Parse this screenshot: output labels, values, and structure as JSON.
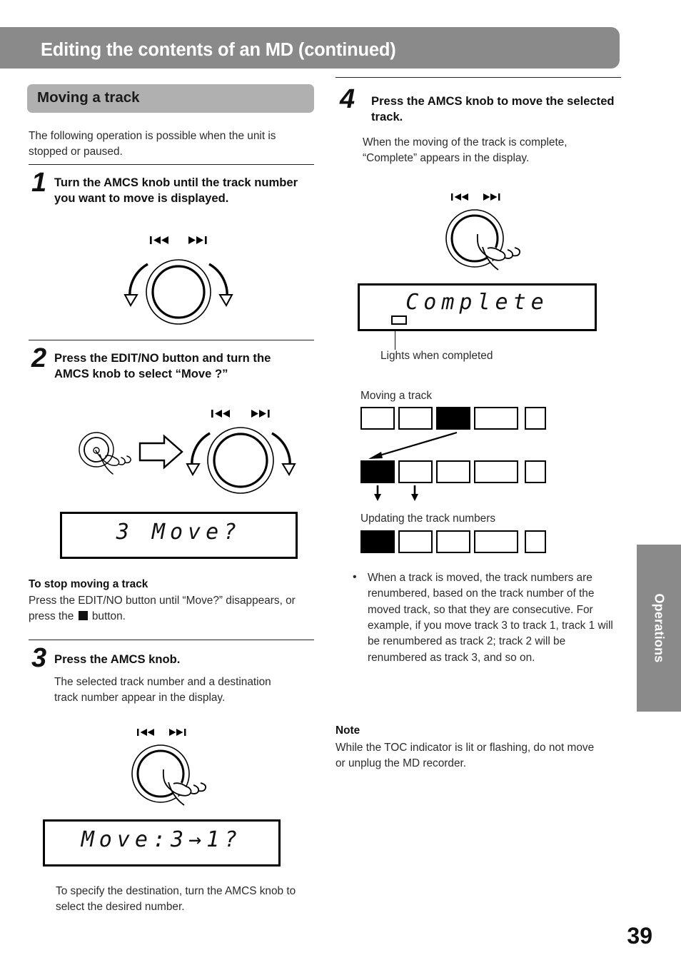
{
  "header": {
    "title": "Editing the contents of an MD (continued)",
    "banner_color": "#8a8a8a"
  },
  "side_tab": {
    "label": "Operations",
    "color": "#8a8a8a"
  },
  "page_number": "39",
  "left_column": {
    "section_heading": "Moving a track",
    "intro": "The following operation is possible when the unit is stopped or paused.",
    "steps": [
      {
        "number": "1",
        "title": "Turn the AMCS knob until the track number you want to move is displayed.",
        "illustration": "knob-rotate",
        "skip_back_icon": "skip-back-icon",
        "skip_fwd_icon": "skip-forward-icon"
      },
      {
        "number": "2",
        "title": "Press the EDIT/NO button and turn the AMCS knob to select “Move ?”",
        "illustration": "press-then-rotate",
        "display_text": "3 Move?"
      },
      {
        "number": "3",
        "title": "Press the AMCS knob.",
        "body": "The selected track number and a destination track number appear in the display.",
        "illustration": "knob-press",
        "display_text": "Move:3→1?",
        "footnote": "To specify the destination, turn the AMCS knob to select the desired number."
      }
    ],
    "stop_section": {
      "heading": "To stop moving a track",
      "text_before": "Press the EDIT/NO button until “Move?” disappears, or press the",
      "text_after": "button.",
      "stop_icon": "stop-button-icon"
    }
  },
  "right_column": {
    "step": {
      "number": "4",
      "title": "Press the AMCS knob to move the selected track.",
      "body": "When the moving of the track is complete, “Complete” appears in the display.",
      "illustration": "knob-press",
      "display_text": "Complete",
      "indicator_caption": "Lights when completed"
    },
    "diagram": {
      "label_top": "Moving a track",
      "label_bottom": "Updating the track numbers",
      "row1": [
        "empty",
        "empty",
        "filled",
        "empty",
        "empty"
      ],
      "row2": [
        "filled",
        "empty",
        "empty",
        "empty",
        "empty"
      ],
      "row3": [
        "filled",
        "empty",
        "empty",
        "empty",
        "empty"
      ]
    },
    "bullet": "When a track is moved, the track numbers are renumbered, based on the track number of the moved track, so that they are consecutive. For example, if you move track 3 to track 1, track 1 will be renumbered as track 2; track 2 will be renumbered as track 3, and so on.",
    "note": {
      "heading": "Note",
      "text": "While the TOC indicator is lit or flashing, do not move or unplug the MD recorder."
    }
  }
}
